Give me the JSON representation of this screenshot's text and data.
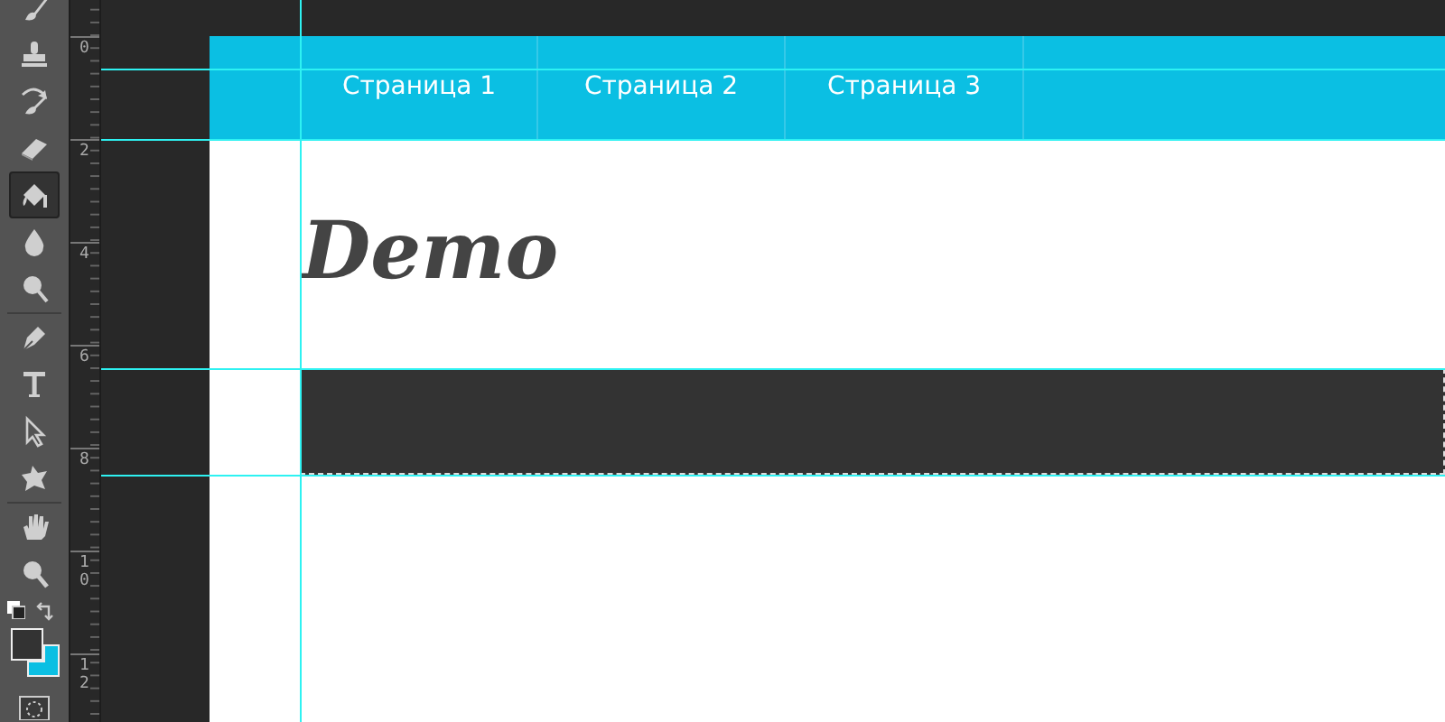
{
  "tool_groups": [
    [
      {
        "kind": "brush",
        "selected": false
      },
      {
        "kind": "stamp",
        "selected": false
      },
      {
        "kind": "history",
        "selected": false
      },
      {
        "kind": "eraser",
        "selected": false
      },
      {
        "kind": "bucket",
        "selected": true
      },
      {
        "kind": "drop",
        "selected": false
      },
      {
        "kind": "dodge",
        "selected": false
      }
    ],
    [
      {
        "kind": "pen",
        "selected": false
      },
      {
        "kind": "type",
        "selected": false
      },
      {
        "kind": "arrow",
        "selected": false
      },
      {
        "kind": "shape",
        "selected": false
      }
    ],
    [
      {
        "kind": "hand",
        "selected": false
      },
      {
        "kind": "zoom",
        "selected": false
      }
    ]
  ],
  "swatches": [
    {
      "kind": "foreground",
      "color": "#333333"
    },
    {
      "kind": "background",
      "color": "#0bbfe3"
    }
  ],
  "ruler_labels": [
    "0",
    "2",
    "4",
    "6",
    "8",
    "10",
    "12"
  ],
  "document": {
    "nav": [
      {
        "label": "Страница 1"
      },
      {
        "label": "Страница 2"
      },
      {
        "label": "Страница 3"
      }
    ],
    "heading": "Demo",
    "band_selected": true
  }
}
